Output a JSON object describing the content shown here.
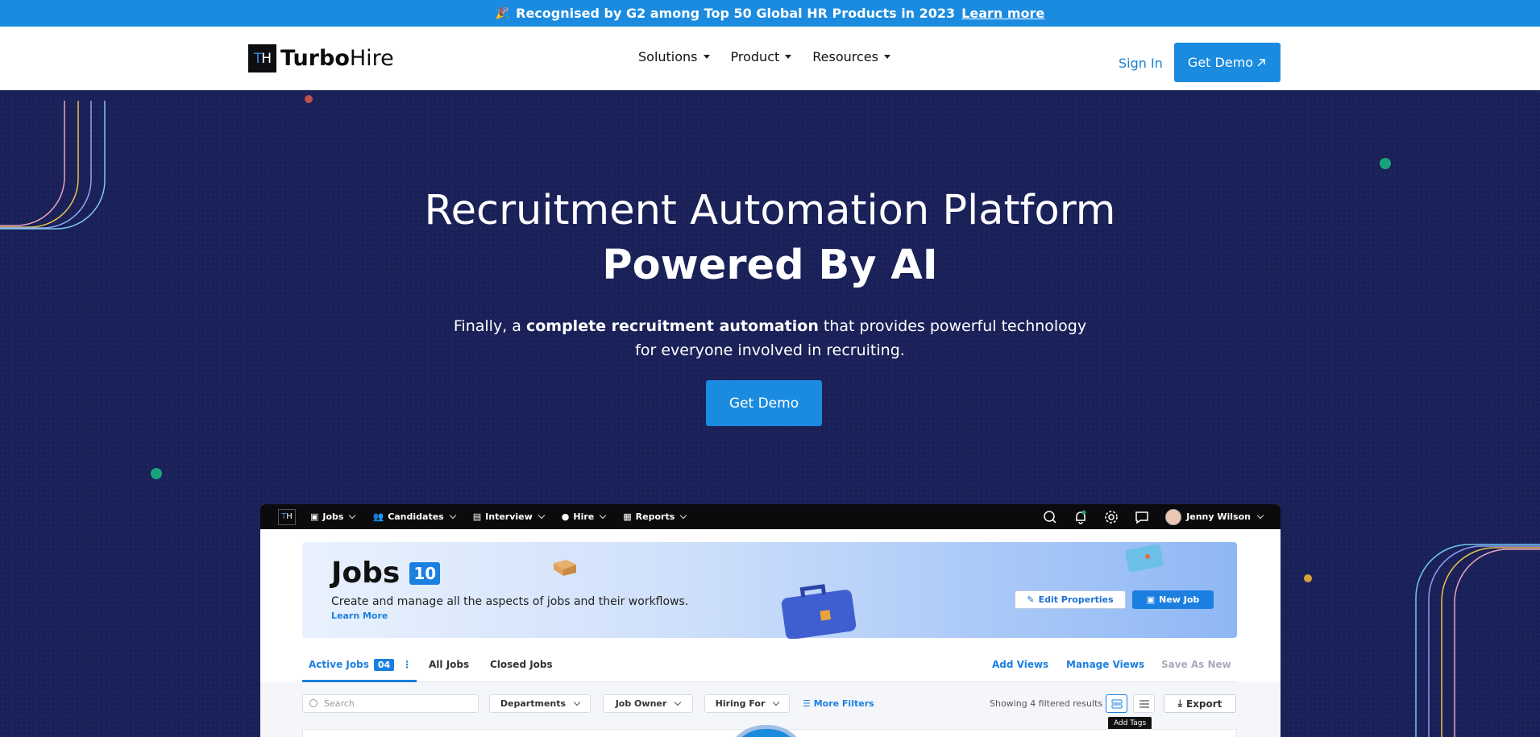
{
  "announcement": {
    "text": "Recognised by G2 among Top 50 Global HR Products in 2023",
    "link": "Learn more"
  },
  "nav": {
    "logo_mark_t": "T",
    "logo_mark_h": "H",
    "logo_bold": "Turbo",
    "logo_light": "Hire",
    "menu": [
      "Solutions",
      "Product",
      "Resources"
    ],
    "sign_in": "Sign In",
    "demo": "Get Demo"
  },
  "hero": {
    "title_line1": "Recruitment Automation Platform",
    "title_line2": "Powered By AI",
    "sub_pre": "Finally, a ",
    "sub_bold": "complete recruitment automation",
    "sub_post": " that provides powerful technology",
    "sub_line2": "for everyone involved in recruiting.",
    "cta": "Get Demo"
  },
  "app": {
    "logo_t": "T",
    "logo_h": "H",
    "menu": [
      "Jobs",
      "Candidates",
      "Interview",
      "Hire",
      "Reports"
    ],
    "user_name": "Jenny Wilson",
    "jobs_title": "Jobs",
    "jobs_count": "10",
    "jobs_desc": "Create and manage all the aspects of jobs and their workflows.",
    "jobs_learn": "Learn More",
    "edit_properties": "Edit Properties",
    "new_job": "New Job",
    "tabs": {
      "active": "Active Jobs",
      "active_count": "04",
      "all": "All Jobs",
      "closed": "Closed Jobs",
      "add_views": "Add Views",
      "manage_views": "Manage Views",
      "save_as_new": "Save As New"
    },
    "filters": {
      "search_placeholder": "Search",
      "departments": "Departments",
      "job_owner": "Job Owner",
      "hiring_for": "Hiring For",
      "more_filters": "More Filters",
      "showing": "Showing 4 filtered results",
      "export": "Export",
      "tooltip": "Add Tags"
    }
  },
  "colors": {
    "brand_blue": "#1b8be0",
    "hero_bg": "#1a2158",
    "link_blue": "#1b7fd0"
  }
}
